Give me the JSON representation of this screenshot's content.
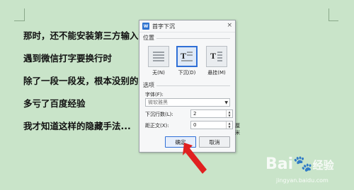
{
  "document": {
    "lines": [
      "那时，还不能安装第三方输入法",
      "遇到微信打字要换行时",
      "除了一段一段发，根本没别的办",
      "多亏了百度经验",
      "我才知道这样的隐藏手法..."
    ]
  },
  "dialog": {
    "app_icon": "W",
    "title": "首字下沉",
    "close": "×",
    "position_section": "位置",
    "positions": [
      {
        "label": "无(N)",
        "icon": "no-dropcap-icon"
      },
      {
        "label": "下沉(D)",
        "icon": "dropped-icon",
        "selected": true
      },
      {
        "label": "悬挂(M)",
        "icon": "margin-icon"
      }
    ],
    "options_section": "选项",
    "font_label": "字体(F):",
    "font_value": "微软雅黑",
    "lines_label": "下沉行数(L):",
    "lines_value": "2",
    "distance_label": "距正文(X):",
    "distance_value": "0",
    "distance_unit": "厘米",
    "ok_label": "确定",
    "cancel_label": "取消"
  },
  "watermark": {
    "brand": "Bai",
    "suffix": "经验",
    "url": "jingyan.baidu.com"
  }
}
